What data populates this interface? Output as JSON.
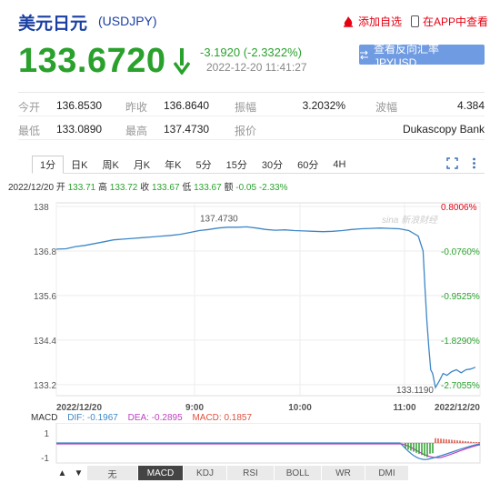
{
  "header": {
    "title": "美元日元",
    "code": "(USDJPY)",
    "add_fav": "添加自选",
    "app_view": "在APP中查看"
  },
  "quote": {
    "price": "133.6720",
    "change": "-3.1920 (-2.3322%)",
    "time": "2022-12-20 11:41:27",
    "reverse_btn": "查看反向汇率 JPYUSD"
  },
  "stats": {
    "open_label": "今开",
    "open": "136.8530",
    "prev_label": "昨收",
    "prev": "136.8640",
    "amp_label": "振幅",
    "amp": "3.2032%",
    "vol_label": "波幅",
    "vol": "4.384",
    "low_label": "最低",
    "low": "133.0890",
    "high_label": "最高",
    "high": "137.4730",
    "quote_label": "报价",
    "quote_src": "Dukascopy Bank"
  },
  "tabs": [
    "1分",
    "日K",
    "周K",
    "月K",
    "年K",
    "5分",
    "15分",
    "30分",
    "60分",
    "4H"
  ],
  "ohlc": {
    "date": "2022/12/20",
    "open_l": "开",
    "open": "133.71",
    "high_l": "高",
    "high": "133.72",
    "close_l": "收",
    "close": "133.67",
    "low_l": "低",
    "low": "133.67",
    "chg_l": "额",
    "chg": "-0.05",
    "pct": "-2.33%"
  },
  "chart_data": {
    "type": "line",
    "y_ticks": [
      "138",
      "136.8",
      "135.6",
      "134.4",
      "133.2"
    ],
    "pct_ticks": [
      "0.8006%",
      "-0.0760%",
      "-0.9525%",
      "-1.8290%",
      "-2.7055%"
    ],
    "x_labels": [
      "2022/12/20",
      "9:00",
      "10:00",
      "11:00",
      "2022/12/20"
    ],
    "high_annotation": "137.4730",
    "low_annotation": "133.1190",
    "watermark": "sina 新浪财经",
    "x": [
      0,
      10,
      20,
      30,
      40,
      50,
      60,
      70,
      80,
      90,
      100,
      110,
      120,
      130,
      140,
      150,
      160,
      170,
      180,
      190,
      200,
      210,
      220,
      230,
      240,
      250,
      260,
      270,
      280,
      290,
      300,
      310,
      320,
      330,
      340,
      350,
      360,
      370,
      380,
      385,
      387,
      389,
      391,
      393,
      395,
      398,
      402,
      406,
      410,
      415,
      420,
      425,
      430,
      435,
      440
    ],
    "y": [
      136.85,
      136.86,
      136.92,
      136.95,
      137.0,
      137.05,
      137.1,
      137.12,
      137.14,
      137.16,
      137.18,
      137.2,
      137.22,
      137.25,
      137.3,
      137.35,
      137.38,
      137.42,
      137.44,
      137.44,
      137.45,
      137.42,
      137.38,
      137.36,
      137.37,
      137.35,
      137.34,
      137.33,
      137.32,
      137.33,
      137.35,
      137.38,
      137.4,
      137.41,
      137.42,
      137.41,
      137.4,
      137.35,
      137.2,
      136.8,
      135.8,
      134.9,
      134.2,
      133.6,
      133.5,
      133.12,
      133.3,
      133.5,
      133.45,
      133.55,
      133.6,
      133.52,
      133.6,
      133.62,
      133.67
    ],
    "ylim": [
      133.0,
      138.0
    ]
  },
  "macd": {
    "label": "MACD",
    "dif": "DIF: -0.1967",
    "dea": "DEA: -0.2895",
    "macd": "MACD: 0.1857",
    "y_ticks": [
      "1",
      "-1"
    ]
  },
  "bottom": {
    "up": "▲",
    "down": "▼",
    "buttons": [
      "无",
      "MACD",
      "KDJ",
      "RSI",
      "BOLL",
      "WR",
      "DMI"
    ]
  },
  "colors": {
    "up_green": "#2aa12d",
    "down_red": "#e60012",
    "title_blue": "#1a3fa3",
    "btn_blue": "#6f9be2",
    "line_blue": "#3d86c6"
  }
}
